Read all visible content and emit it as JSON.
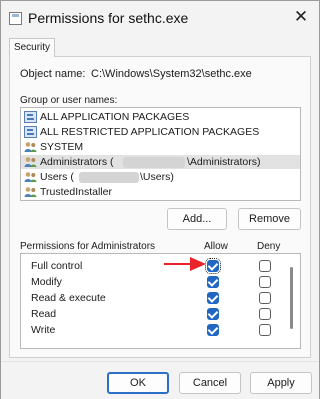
{
  "window": {
    "title": "Permissions for sethc.exe",
    "close_glyph": "✕"
  },
  "tabs": [
    {
      "label": "Security"
    }
  ],
  "object": {
    "label": "Object name:",
    "value": "C:\\Windows\\System32\\sethc.exe"
  },
  "groups": {
    "label": "Group or user names:",
    "items": [
      {
        "label": "ALL APPLICATION PACKAGES",
        "icon": "package-icon",
        "selected": false
      },
      {
        "label": "ALL RESTRICTED APPLICATION PACKAGES",
        "icon": "package-icon",
        "selected": false
      },
      {
        "label": "SYSTEM",
        "icon": "users-icon",
        "selected": false
      },
      {
        "label": "Administrators (",
        "suffix": "\\Administrators)",
        "icon": "users-icon",
        "selected": true,
        "redacted": true
      },
      {
        "label": "Users (",
        "suffix": "\\Users)",
        "icon": "users-icon",
        "selected": false,
        "redacted": true
      },
      {
        "label": "TrustedInstaller",
        "icon": "users-icon",
        "selected": false
      }
    ],
    "add_label": "Add...",
    "remove_label": "Remove"
  },
  "permissions": {
    "label": "Permissions for Administrators",
    "allow_header": "Allow",
    "deny_header": "Deny",
    "rows": [
      {
        "label": "Full control",
        "allow": true,
        "deny": false
      },
      {
        "label": "Modify",
        "allow": true,
        "deny": false
      },
      {
        "label": "Read & execute",
        "allow": true,
        "deny": false
      },
      {
        "label": "Read",
        "allow": true,
        "deny": false
      },
      {
        "label": "Write",
        "allow": true,
        "deny": false
      }
    ]
  },
  "footer": {
    "ok_label": "OK",
    "cancel_label": "Cancel",
    "apply_label": "Apply"
  },
  "colors": {
    "accent": "#1f67c1",
    "annotation_arrow": "#e8232a"
  }
}
